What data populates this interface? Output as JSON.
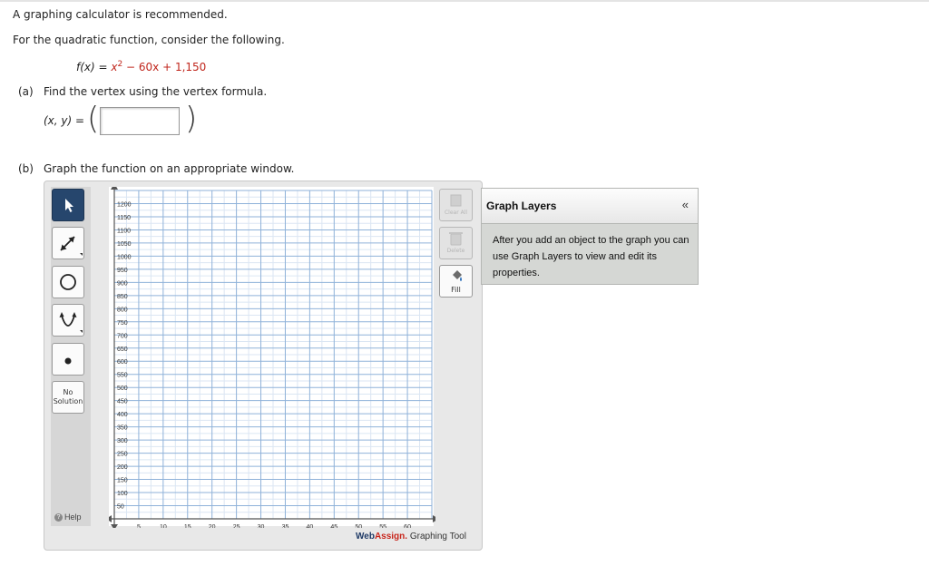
{
  "intro": "A graphing calculator is recommended.",
  "prompt": "For the quadratic function, consider the following.",
  "function": {
    "lhs": "f(x) = ",
    "x": "x",
    "exp": "2",
    "rest": " − 60x + 1,150"
  },
  "part_a": {
    "letter": "(a)",
    "text": "Find the vertex using the vertex formula.",
    "answer_label": "(x, y) =",
    "answer_value": ""
  },
  "part_b": {
    "letter": "(b)",
    "text": "Graph the function on an appropriate window."
  },
  "tools": {
    "no_solution_line1": "No",
    "no_solution_line2": "Solution",
    "help": "Help",
    "clear_all": "Clear All",
    "delete": "Delete",
    "fill": "Fill"
  },
  "graph": {
    "x_ticks": [
      "5",
      "10",
      "15",
      "20",
      "25",
      "30",
      "35",
      "40",
      "45",
      "50",
      "55",
      "60"
    ],
    "y_ticks": [
      "50",
      "100",
      "150",
      "200",
      "250",
      "300",
      "350",
      "400",
      "450",
      "500",
      "550",
      "600",
      "650",
      "700",
      "750",
      "800",
      "850",
      "900",
      "950",
      "1000",
      "1050",
      "1100",
      "1150",
      "1200"
    ],
    "x_range": [
      0,
      65
    ],
    "y_range": [
      0,
      1250
    ],
    "grid": true
  },
  "brand": {
    "web": "Web",
    "assign": "Assign.",
    "suffix": " Graphing Tool"
  },
  "layers": {
    "title": "Graph Layers",
    "collapse": "«",
    "body": "After you add an object to the graph you can use Graph Layers to view and edit its properties."
  },
  "colors": {
    "accent_red": "#c0261c",
    "active_tool": "#26466d",
    "grid_major": "#8fb2d9",
    "grid_minor": "#dbe6f3"
  }
}
